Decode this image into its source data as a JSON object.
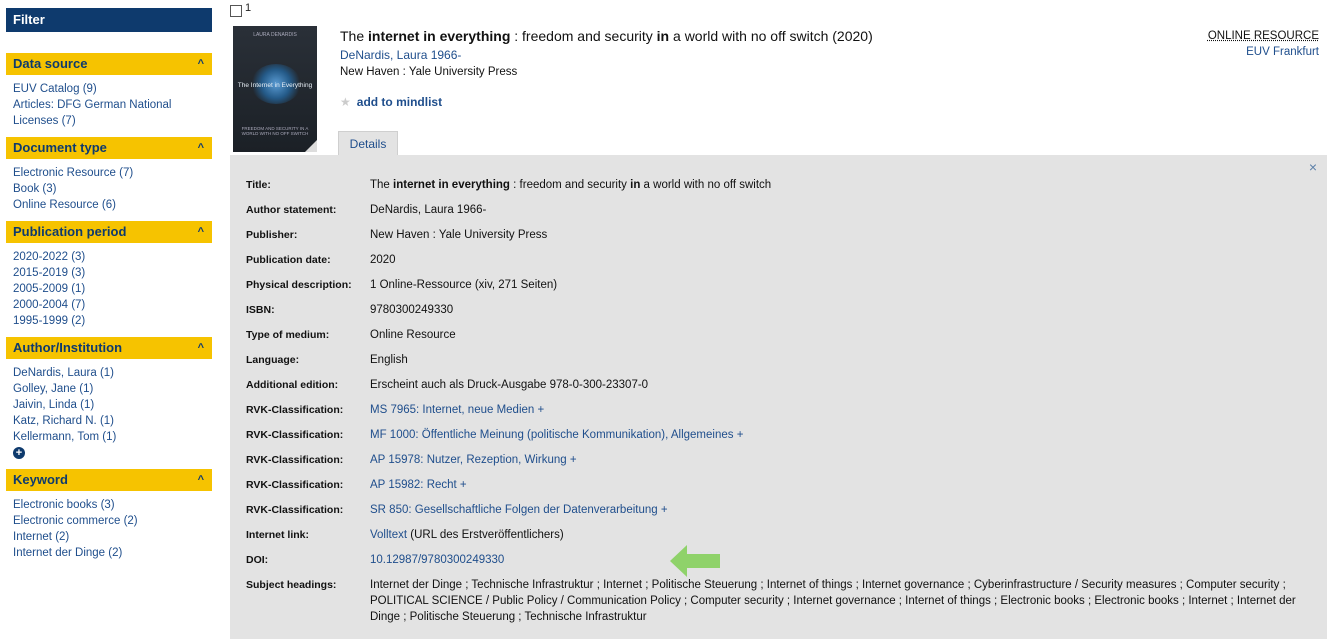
{
  "sidebar": {
    "filter_title": "Filter",
    "facets": [
      {
        "title": "Data source",
        "items": [
          {
            "label": "EUV Catalog",
            "count": "(9)"
          },
          {
            "label": "Articles: DFG German National Licenses",
            "count": "(7)"
          }
        ]
      },
      {
        "title": "Document type",
        "items": [
          {
            "label": "Electronic Resource",
            "count": "(7)"
          },
          {
            "label": "Book",
            "count": "(3)"
          },
          {
            "label": "Online Resource",
            "count": "(6)"
          }
        ]
      },
      {
        "title": "Publication period",
        "items": [
          {
            "label": "2020-2022",
            "count": "(3)"
          },
          {
            "label": "2015-2019",
            "count": "(3)"
          },
          {
            "label": "2005-2009",
            "count": "(1)"
          },
          {
            "label": "2000-2004",
            "count": "(7)"
          },
          {
            "label": "1995-1999",
            "count": "(2)"
          }
        ]
      },
      {
        "title": "Author/Institution",
        "items": [
          {
            "label": "DeNardis, Laura",
            "count": "(1)"
          },
          {
            "label": "Golley, Jane",
            "count": "(1)"
          },
          {
            "label": "Jaivin, Linda",
            "count": "(1)"
          },
          {
            "label": "Katz, Richard N.",
            "count": "(1)"
          },
          {
            "label": "Kellermann, Tom",
            "count": "(1)"
          }
        ]
      },
      {
        "title": "Keyword",
        "items": [
          {
            "label": "Electronic books",
            "count": "(3)"
          },
          {
            "label": "Electronic commerce",
            "count": "(2)"
          },
          {
            "label": "Internet",
            "count": "(2)"
          },
          {
            "label": "Internet der Dinge",
            "count": "(2)"
          }
        ]
      }
    ]
  },
  "record": {
    "number": "1",
    "title_pre": "The ",
    "title_bold": "internet in everything",
    "title_post": " : freedom and security ",
    "title_bold2": "in",
    "title_post2": " a world with no off switch (2020)",
    "author": "DeNardis, Laura 1966-",
    "publisher": "New Haven : Yale University Press",
    "mindlist": "add to mindlist",
    "resource_type": "ONLINE RESOURCE",
    "location": "EUV Frankfurt",
    "cover": {
      "author": "LAURA DENARDIS",
      "title": "The Internet in Everything",
      "subtitle": "FREEDOM AND SECURITY IN A WORLD WITH NO OFF SWITCH"
    }
  },
  "details": {
    "tab_label": "Details",
    "close": "×",
    "rows": [
      {
        "label": "Title:",
        "value": "The internet in everything : freedom and security in a world with no off switch"
      },
      {
        "label": "Author statement:",
        "value": "DeNardis, Laura 1966-"
      },
      {
        "label": "Publisher:",
        "value": "New Haven : Yale University Press"
      },
      {
        "label": "Publication date:",
        "value": "2020"
      },
      {
        "label": "Physical description:",
        "value": "1 Online-Ressource (xiv, 271 Seiten)"
      },
      {
        "label": "ISBN:",
        "value": "9780300249330"
      },
      {
        "label": "Type of medium:",
        "value": "Online Resource"
      },
      {
        "label": "Language:",
        "value": "English"
      },
      {
        "label": "Additional edition:",
        "value": "Erscheint auch als Druck-Ausgabe 978-0-300-23307-0"
      },
      {
        "label": "RVK-Classification:",
        "value": "MS 7965: Internet, neue Medien  +"
      },
      {
        "label": "RVK-Classification:",
        "value": "MF 1000: Öffentliche Meinung (politische Kommunikation), Allgemeines  +"
      },
      {
        "label": "RVK-Classification:",
        "value": "AP 15978: Nutzer, Rezeption, Wirkung  +"
      },
      {
        "label": "RVK-Classification:",
        "value": "AP 15982: Recht  +"
      },
      {
        "label": "RVK-Classification:",
        "value": "SR 850: Gesellschaftliche Folgen der Datenverarbeitung  +"
      },
      {
        "label": "Internet link:",
        "value": "Volltext",
        "value_suffix": " (URL des Erstveröffentlichers)"
      },
      {
        "label": "DOI:",
        "value": "10.12987/9780300249330"
      },
      {
        "label": "Subject headings:",
        "value": "Internet der Dinge ; Technische Infrastruktur ; Internet ; Politische Steuerung ; Internet of things ; Internet governance ; Cyberinfrastructure / Security measures ; Computer security ; POLITICAL SCIENCE / Public Policy / Communication Policy ; Computer security ; Internet governance ; Internet of things ; Electronic books ; Electronic books ; Internet ; Internet der Dinge ; Politische Steuerung ; Technische Infrastruktur"
      }
    ]
  },
  "colors": {
    "navy": "#0e3a6d",
    "yellow": "#f6c300",
    "link": "#1f4e8c",
    "panel": "#e3e3e3",
    "arrow": "#8fd26a"
  },
  "icons": {
    "facet_collapse": "chevron-up-icon",
    "more": "plus-circle-icon",
    "star": "star-icon",
    "arrow": "arrow-left-icon"
  }
}
